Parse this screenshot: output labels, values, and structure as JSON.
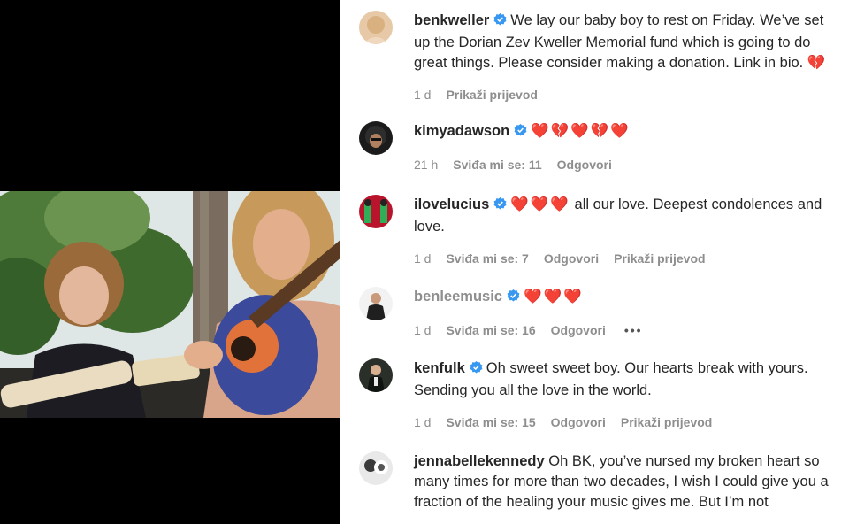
{
  "post": {
    "media_alt": "",
    "colors": {
      "text": "#262626",
      "muted": "#8e8e8e",
      "verified": "#3897f0",
      "heart": "#d9263b"
    }
  },
  "ui": {
    "likes_prefix": "Sviđa mi se:",
    "reply_label": "Odgovori",
    "translate_label": "Prikaži prijevod",
    "more_icon": "•••"
  },
  "comments": [
    {
      "username": "benkweller",
      "verified": true,
      "text": "We lay our baby boy to rest on Friday. We’ve set up the Dorian Zev Kweller Memorial fund which is going to do great things. Please consider making a donation. Link in bio.",
      "emoji": "💔",
      "time": "1 d",
      "translate": "Prikaži prijevod"
    },
    {
      "username": "kimyadawson",
      "verified": true,
      "text": "",
      "emoji": "❤️💔❤️💔❤️",
      "time": "21 h",
      "likes": "Sviđa mi se: 11",
      "reply": "Odgovori"
    },
    {
      "username": "ilovelucius",
      "verified": true,
      "emoji": "❤️❤️❤️",
      "text": "all our love. Deepest condolences and love.",
      "time": "1 d",
      "likes": "Sviđa mi se: 7",
      "reply": "Odgovori",
      "translate": "Prikaži prijevod"
    },
    {
      "username": "benleemusic",
      "verified": true,
      "emoji": "❤️❤️❤️",
      "text": "",
      "time": "1 d",
      "likes": "Sviđa mi se: 16",
      "reply": "Odgovori",
      "more": "•••"
    },
    {
      "username": "kenfulk",
      "verified": true,
      "text": "Oh sweet sweet boy. Our hearts break with yours. Sending you all the love in the world.",
      "time": "1 d",
      "likes": "Sviđa mi se: 15",
      "reply": "Odgovori",
      "translate": "Prikaži prijevod"
    },
    {
      "username": "jennabellekennedy",
      "verified": false,
      "text": "Oh BK, you’ve nursed my broken heart so many times for more than two decades, I wish I could give you a fraction of the healing your music gives me. But I’m not"
    }
  ]
}
